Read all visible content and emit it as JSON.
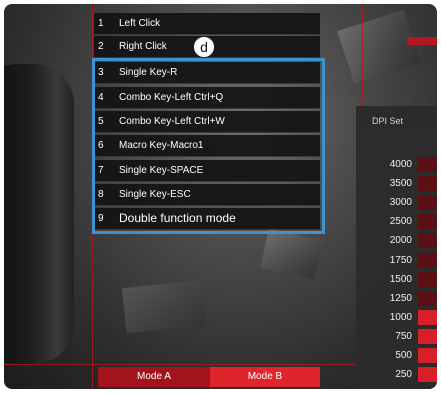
{
  "main": {
    "mouse_button_number": "2",
    "callout_letter": "d",
    "menu": [
      {
        "num": "1",
        "label": "Left Click"
      },
      {
        "num": "2",
        "label": "Right Click"
      },
      {
        "num": "3",
        "label": "Single Key-R"
      },
      {
        "num": "4",
        "label": "Combo Key-Left Ctrl+Q"
      },
      {
        "num": "5",
        "label": "Combo Key-Left Ctrl+W"
      },
      {
        "num": "6",
        "label": "Macro Key-Macro1"
      },
      {
        "num": "7",
        "label": "Single Key-SPACE"
      },
      {
        "num": "8",
        "label": "Single Key-ESC"
      },
      {
        "num": "9",
        "label": "Double function mode"
      }
    ],
    "modes": {
      "a": "Mode A",
      "b": "Mode B"
    }
  },
  "dpi": {
    "title": "DPI Set",
    "values": [
      "4000",
      "3500",
      "3000",
      "2500",
      "2000",
      "1750",
      "1500",
      "1250",
      "1000",
      "750",
      "500",
      "250"
    ]
  },
  "colors": {
    "accent_red": "#d81e27",
    "highlight_blue": "#3b93d6"
  }
}
